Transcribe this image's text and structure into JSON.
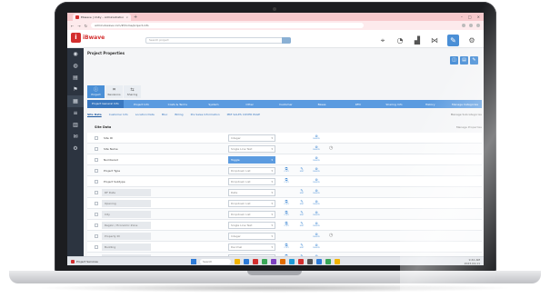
{
  "browser": {
    "tab_title": "Ebwave | Unity – Administration",
    "tab_close": "×",
    "new_tab": "+",
    "window_controls": [
      "–",
      "□",
      "×"
    ],
    "nav": [
      "←",
      "→",
      "↻"
    ],
    "url": "admin.ibwave.com/#/home/project-info"
  },
  "app": {
    "brand": "iBwave",
    "brand_glyph": "i",
    "search_placeholder": "Search project",
    "header_icons": [
      "pin-icon",
      "gauge-icon",
      "chart-icon",
      "network-icon",
      "wrench-icon",
      "gear-icon",
      "help-icon"
    ],
    "header_glyphs": [
      "⌖",
      "◔",
      "▟",
      "⋈",
      "✎",
      "⚙",
      "?"
    ]
  },
  "sidebar": {
    "items": [
      "home-icon",
      "user-icon",
      "doc-icon",
      "flag-icon",
      "building-icon",
      "list-icon",
      "folder-icon",
      "mail-icon",
      "settings-icon"
    ],
    "glyphs": [
      "◉",
      "◍",
      "▤",
      "⚑",
      "▦",
      "≡",
      "▥",
      "✉",
      "⚙"
    ]
  },
  "page": {
    "title": "Project Properties",
    "right_actions": [
      "◫",
      "▤",
      "✎"
    ]
  },
  "modes": [
    {
      "icon": "ⓘ",
      "label": "Project"
    },
    {
      "icon": "⌗",
      "label": "Revisions"
    },
    {
      "icon": "⇆",
      "label": "Sharing"
    }
  ],
  "strip": {
    "tabs": [
      "Project General Info",
      "Project Info",
      "Costs & Terms",
      "System",
      "Other",
      "Customer",
      "Bases",
      "RFD",
      "Sharing Info",
      "History"
    ],
    "manage": "Manage Categories"
  },
  "subtabs": {
    "items": [
      "Site Data",
      "Customer Info",
      "Location Data",
      "Misc",
      "Billing",
      "Pre Sales Information",
      "PRE SALES COVER PAGE"
    ],
    "manage": "Manage Subcategories"
  },
  "section": {
    "title": "Site Data",
    "manage": "Manage Properties"
  },
  "action_captions": {
    "copy": "COPY",
    "edit": "EDIT",
    "delete": "DELETE"
  },
  "action_glyphs": {
    "copy": "⧉",
    "edit": "✎",
    "delete": "⊗",
    "clock": "◷"
  },
  "rows": [
    {
      "label": "Site ID",
      "field": "Integer",
      "kind": "field",
      "gray": false,
      "acts": [
        "",
        "",
        "del"
      ],
      "extra": ""
    },
    {
      "label": "Site Name",
      "field": "Single Line Text",
      "kind": "field",
      "gray": false,
      "acts": [
        "",
        "",
        "del"
      ],
      "extra": "clock"
    },
    {
      "label": "Numbered",
      "field": "Toggle",
      "kind": "blue",
      "gray": false,
      "acts": [
        "",
        "",
        "del"
      ],
      "extra": ""
    },
    {
      "label": "Project Type",
      "field": "Dropdown List",
      "kind": "field",
      "gray": false,
      "acts": [
        "copy",
        "edit",
        "del"
      ],
      "extra": ""
    },
    {
      "label": "Project Subtype",
      "field": "Dropdown List",
      "kind": "field",
      "gray": false,
      "acts": [
        "copy",
        "",
        "del"
      ],
      "extra": ""
    },
    {
      "label": "RF Date",
      "field": "Date",
      "kind": "field",
      "gray": true,
      "acts": [
        "",
        "edit",
        "del"
      ],
      "extra": ""
    },
    {
      "label": "Opening",
      "field": "Dropdown List",
      "kind": "field",
      "gray": true,
      "acts": [
        "copy",
        "edit",
        "del"
      ],
      "extra": ""
    },
    {
      "label": "City",
      "field": "Dropdown List",
      "kind": "field",
      "gray": true,
      "acts": [
        "copy",
        "edit",
        "del"
      ],
      "extra": ""
    },
    {
      "label": "Region / Economic Zone",
      "field": "Single Line Text",
      "kind": "field",
      "gray": true,
      "acts": [
        "copy",
        "edit",
        "del"
      ],
      "extra": ""
    },
    {
      "label": "Property ID",
      "field": "Integer",
      "kind": "field",
      "gray": true,
      "acts": [
        "",
        "",
        "del"
      ],
      "extra": "clock"
    },
    {
      "label": "Building",
      "field": "Decimal",
      "kind": "field",
      "gray": true,
      "acts": [
        "copy",
        "edit",
        "del"
      ],
      "extra": ""
    },
    {
      "label": "Training Date",
      "field": "Date",
      "kind": "field",
      "gray": true,
      "acts": [
        "copy",
        "edit",
        "del"
      ],
      "extra": ""
    }
  ],
  "taskbar": {
    "app_label": "Project Services",
    "search": "Search",
    "time": "9:41 AM",
    "date": "2023-04-11",
    "app_colors": [
      "#f2b300",
      "#2d7bd8",
      "#d32f2f",
      "#3aa757",
      "#7b3fbf",
      "#e06c00",
      "#1f9bd7",
      "#d32f2f",
      "#555555",
      "#2d7bd8",
      "#3aa757",
      "#f2b300"
    ]
  }
}
